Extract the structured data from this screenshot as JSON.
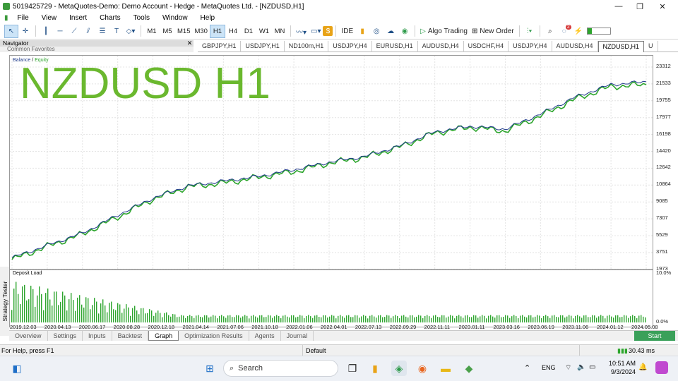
{
  "window": {
    "title": "5019425729 - MetaQuotes-Demo: Demo Account - Hedge - MetaQuotes Ltd. - [NZDUSD,H1]"
  },
  "menu": [
    "File",
    "View",
    "Insert",
    "Charts",
    "Tools",
    "Window",
    "Help"
  ],
  "toolbar": {
    "timeframes": [
      "M1",
      "M5",
      "M15",
      "M30",
      "H1",
      "H4",
      "D1",
      "W1",
      "MN"
    ],
    "active_timeframe": "H1",
    "ide_label": "IDE",
    "algo_label": "Algo Trading",
    "order_label": "New Order",
    "notification_count": "2"
  },
  "navigator": {
    "title": "Navigator",
    "subtabs": "Common   Favorites"
  },
  "symbol_tabs": [
    "GBPJPY,H1",
    "USDJPY,H1",
    "ND100m,H1",
    "USDJPY,H4",
    "EURUSD,H1",
    "AUDUSD,H4",
    "USDCHF,H4",
    "USDJPY,H4",
    "AUDUSD,H4",
    "NZDUSD,H1",
    "U"
  ],
  "active_symbol_tab": "NZDUSD,H1",
  "overlay_title": "NZDUSD H1",
  "legend": {
    "balance": "Balance",
    "sep": " / ",
    "equity": "Equity"
  },
  "deposit_label": "Deposit Load",
  "y_axis": [
    "23312",
    "21533",
    "19755",
    "17977",
    "16198",
    "14420",
    "12642",
    "10864",
    "9085",
    "7307",
    "5529",
    "3751",
    "1973"
  ],
  "deposit_axis": [
    "10.0%",
    "0.0%"
  ],
  "x_axis": [
    "2019.12.03",
    "2020.04.13",
    "2020.06.17",
    "2020.08.28",
    "2020.12.18",
    "2021.04.14",
    "2021.07.06",
    "2021.10.18",
    "2022.01.06",
    "2022.04.01",
    "2022.07.13",
    "2022.09.29",
    "2022.11.11",
    "2023.01.11",
    "2023.03.16",
    "2023.06.19",
    "2023.11.06",
    "2024.01.12",
    "2024.05.08"
  ],
  "strategy_tester_label": "Strategy Tester",
  "bottom_tabs": [
    "Overview",
    "Settings",
    "Inputs",
    "Backtest",
    "Graph",
    "Optimization Results",
    "Agents",
    "Journal"
  ],
  "active_bottom_tab": "Graph",
  "start_label": "Start",
  "status": {
    "help": "For Help, press F1",
    "profile": "Default",
    "ping": "30.43 ms"
  },
  "taskbar": {
    "search": "Search",
    "lang": "ENG",
    "time": "10:51 AM",
    "date": "9/3/2024"
  },
  "chart_data": {
    "type": "line",
    "x": [
      "2019.12.03",
      "2020.04.13",
      "2020.06.17",
      "2020.08.28",
      "2020.12.18",
      "2021.04.14",
      "2021.07.06",
      "2021.10.18",
      "2022.01.06",
      "2022.04.01",
      "2022.07.13",
      "2022.09.29",
      "2022.11.11",
      "2023.01.11",
      "2023.03.16",
      "2023.06.19",
      "2023.11.06",
      "2024.01.12",
      "2024.05.08"
    ],
    "series": [
      {
        "name": "Balance",
        "values": [
          3000,
          4300,
          5600,
          7500,
          9300,
          10600,
          11100,
          11600,
          12300,
          13100,
          13700,
          14800,
          16300,
          16900,
          16600,
          18200,
          20000,
          21300,
          21600
        ]
      },
      {
        "name": "Equity",
        "values": [
          2800,
          4200,
          5500,
          7300,
          9200,
          10500,
          10900,
          11500,
          12100,
          13000,
          13600,
          14700,
          16200,
          16800,
          16400,
          18000,
          19800,
          21100,
          21300
        ]
      }
    ],
    "ylim": [
      1973,
      23312
    ],
    "colors": {
      "balance": "#1f3a8a",
      "equity": "#2da52d"
    },
    "deposit_load_ylim": [
      0,
      10.0
    ],
    "grid": true
  }
}
